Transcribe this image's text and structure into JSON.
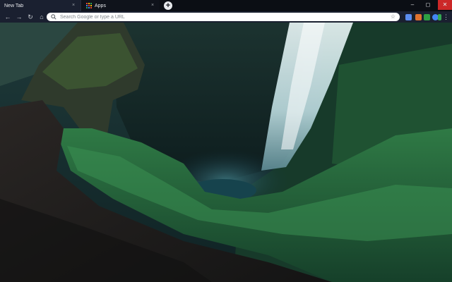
{
  "tabs": [
    {
      "label": "New Tab",
      "active": true
    },
    {
      "label": "Apps",
      "active": false
    }
  ],
  "tab_close_glyph": "×",
  "new_tab_glyph": "+",
  "window_controls": {
    "minimize": "‒",
    "maximize": "◻",
    "close": "✕"
  },
  "toolbar": {
    "back": "←",
    "forward": "→",
    "reload": "↻",
    "home": "⌂",
    "bookmark_star": "☆",
    "menu": "⋮"
  },
  "omnibox": {
    "placeholder": "Search Google or type a URL",
    "value": ""
  },
  "extensions": [
    {
      "name": "extension-1-icon",
      "color": "#5b8def"
    },
    {
      "name": "extension-2-icon",
      "color": "#e0722f"
    },
    {
      "name": "extension-3-icon",
      "color": "#2ea043"
    },
    {
      "name": "extension-4-icon",
      "color": "#4285f4"
    },
    {
      "name": "extension-5-icon",
      "color": "#34a853"
    }
  ],
  "colors": {
    "tabstrip": "#0b0e14",
    "toolbar": "#1a2030",
    "close_button": "#cc2828"
  }
}
